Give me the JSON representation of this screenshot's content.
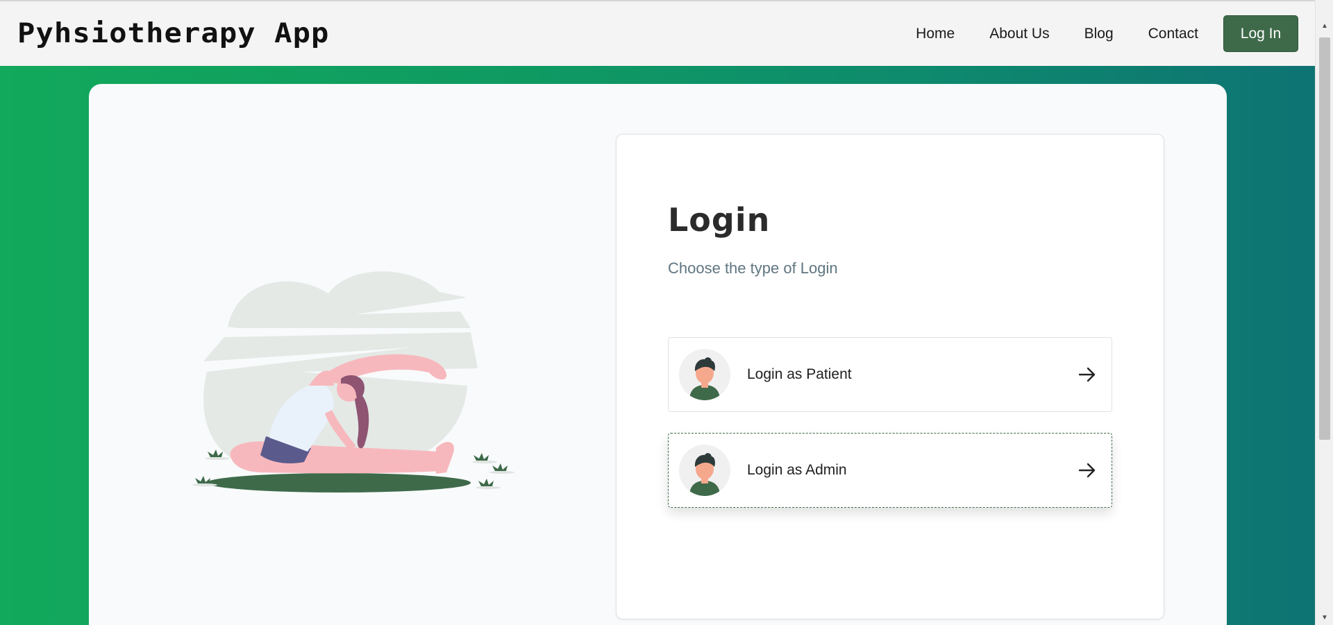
{
  "brand": "Pyhsiotherapy App",
  "nav": {
    "home": "Home",
    "about": "About Us",
    "blog": "Blog",
    "contact": "Contact",
    "login": "Log In"
  },
  "login": {
    "title": "Login",
    "subtitle": "Choose the type of Login",
    "options": [
      {
        "label": "Login as Patient"
      },
      {
        "label": "Login as Admin"
      }
    ]
  },
  "colors": {
    "accent": "#3e6a4a",
    "gradient_start": "#12a95c",
    "gradient_end": "#0e7373"
  },
  "icons": {
    "option_arrow": "arrow-right-icon",
    "option_avatar": "user-avatar-icon"
  }
}
